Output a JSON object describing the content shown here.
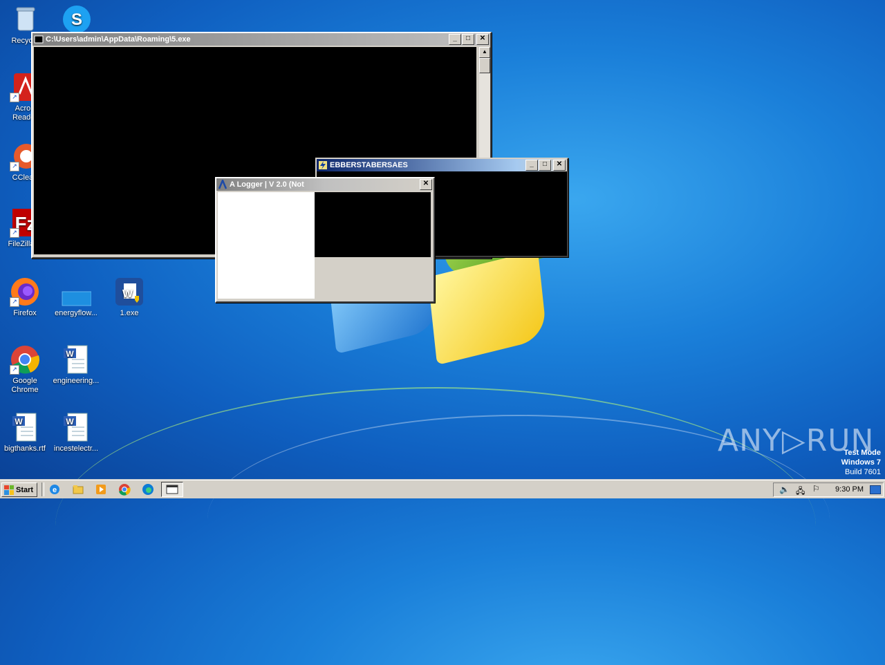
{
  "desktop": {
    "icons": [
      {
        "label": "Recycle Bin",
        "icon": "recycle-bin-icon"
      },
      {
        "label": "Skype",
        "icon": "skype-icon"
      },
      {
        "label": "Acrobat Reader DC",
        "icon": "acrobat-reader-icon"
      },
      {
        "label": "CCleaner",
        "icon": "ccleaner-icon"
      },
      {
        "label": "FileZilla Client",
        "icon": "filezilla-icon"
      },
      {
        "label": "Firefox",
        "icon": "firefox-icon"
      },
      {
        "label": "energyflow...",
        "icon": "blank-file-icon"
      },
      {
        "label": "1.exe",
        "icon": "word-exe-icon"
      },
      {
        "label": "Google Chrome",
        "icon": "chrome-icon"
      },
      {
        "label": "engineering...",
        "icon": "word-document-icon"
      },
      {
        "label": "bigthanks.rtf",
        "icon": "word-document-icon"
      },
      {
        "label": "incestelectr...",
        "icon": "word-document-icon"
      }
    ],
    "labels_visible": {
      "recycle": "Recycle",
      "acrobat_line1": "Acrob",
      "acrobat_line2": "Reader",
      "ccleaner": "CClean",
      "filezilla": "FileZilla C",
      "firefox": "Firefox",
      "energyflow": "energyflow...",
      "exe1": "1.exe",
      "chrome_line1": "Google",
      "chrome_line2": "Chrome",
      "engineering": "engineering...",
      "bigthanks": "bigthanks.rtf",
      "incest": "incestelectr..."
    }
  },
  "windows": {
    "console": {
      "title": "C:\\Users\\admin\\AppData\\Roaming\\5.exe"
    },
    "ebber": {
      "title": "EBBERSTABERSAES"
    },
    "logger": {
      "title": "A Logger  |  V 2.0 (Not"
    }
  },
  "titlebar_buttons": {
    "minimize": "_",
    "maximize": "□",
    "close": "✕"
  },
  "watermark": "ANY▷RUN",
  "test_mode": {
    "line1": "Test Mode",
    "line2": "Windows 7",
    "line3": "Build 7601"
  },
  "taskbar": {
    "start_label": "Start",
    "clock": "9:30 PM"
  },
  "colors": {
    "desktop_blue": "#1a7fd9",
    "title_active": "#0a246a",
    "title_inactive": "#808080"
  }
}
